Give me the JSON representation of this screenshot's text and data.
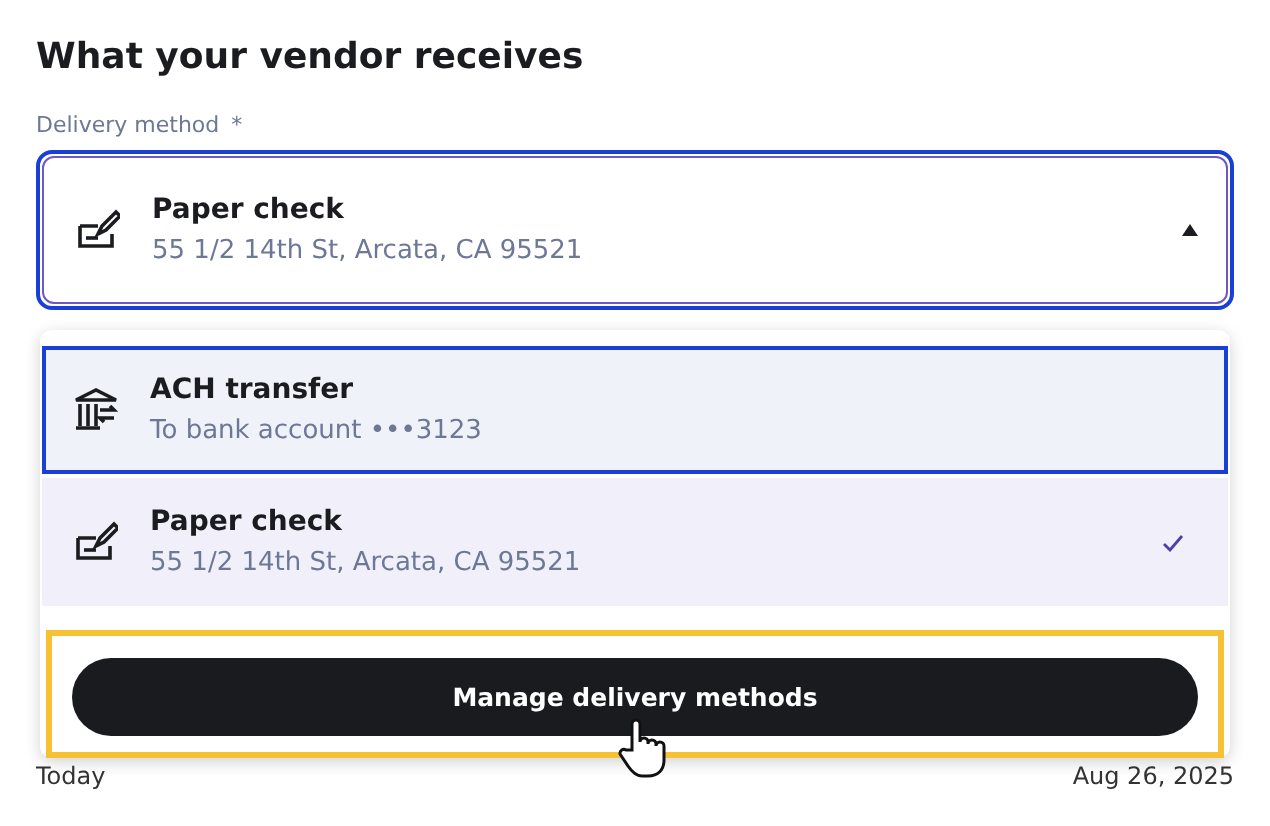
{
  "heading": "What your vendor receives",
  "field": {
    "label": "Delivery method",
    "required_mark": "*",
    "title": "Paper check",
    "subtitle": "55 1/2 14th St, Arcata, CA 95521",
    "expanded": true
  },
  "options": [
    {
      "kind": "bank",
      "title": "ACH transfer",
      "subtitle": "To bank account •••3123",
      "focused": true,
      "selected": false
    },
    {
      "kind": "check",
      "title": "Paper check",
      "subtitle": "55 1/2 14th St, Arcata, CA 95521",
      "focused": false,
      "selected": true
    }
  ],
  "manage_button": "Manage delivery methods",
  "dates": [
    "Today",
    "Aug 26, 2025"
  ]
}
